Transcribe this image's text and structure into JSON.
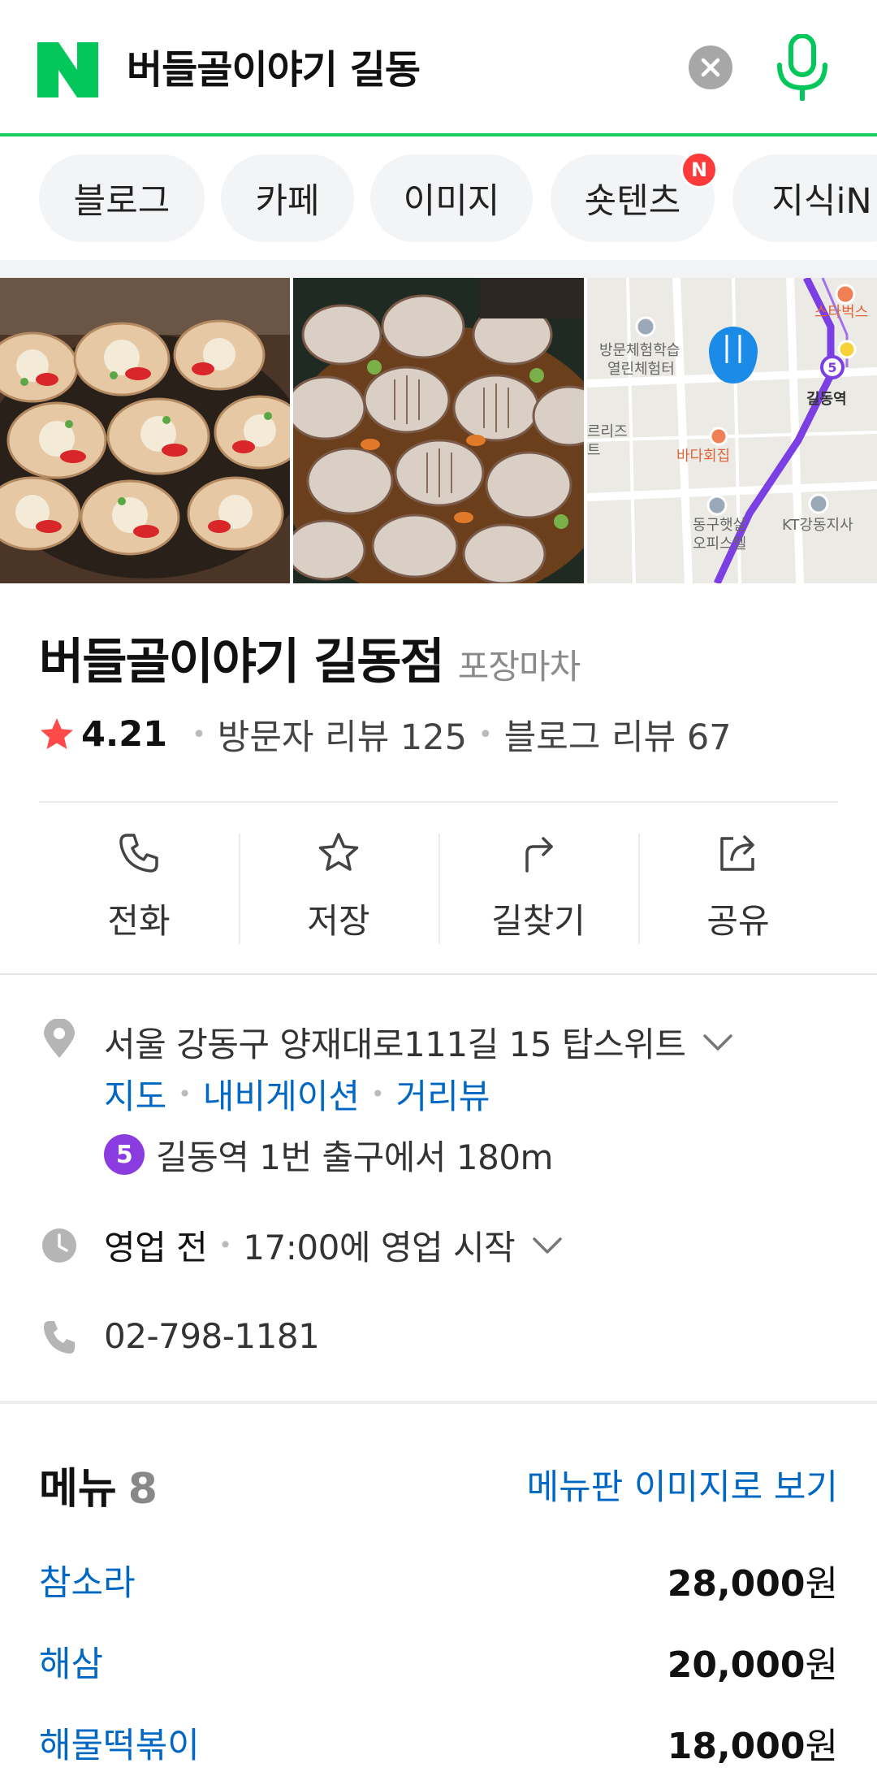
{
  "search": {
    "query": "버들골이야기 길동"
  },
  "tabs": [
    {
      "label": "블로그",
      "new": false
    },
    {
      "label": "카페",
      "new": false
    },
    {
      "label": "이미지",
      "new": false
    },
    {
      "label": "숏텐츠",
      "new": true,
      "badge": "N"
    },
    {
      "label": "지식iN",
      "new": false
    }
  ],
  "photos": {
    "map_labels": {
      "poi_1": "방문체험학습",
      "poi_1b": "열린체험터",
      "station": "길동역",
      "restaurant": "바다회집",
      "poi_2": "동구햇살",
      "poi_2b": "오피스텔",
      "poi_3": "KT강동지사",
      "poi_4": "스타벅스",
      "left_cut_1": "르리즈",
      "left_cut_2": "트"
    }
  },
  "place": {
    "name": "버들골이야기 길동점",
    "category": "포장마차",
    "rating": "4.21",
    "visitor_reviews": "방문자 리뷰 125",
    "blog_reviews": "블로그 리뷰 67"
  },
  "actions": [
    {
      "label": "전화",
      "icon": "phone-icon"
    },
    {
      "label": "저장",
      "icon": "star-outline-icon"
    },
    {
      "label": "길찾기",
      "icon": "directions-icon"
    },
    {
      "label": "공유",
      "icon": "share-icon"
    }
  ],
  "info": {
    "address": "서울 강동구 양재대로111길 15 탑스위트",
    "links": [
      "지도",
      "내비게이션",
      "거리뷰"
    ],
    "subway_line": "5",
    "subway_text": "길동역 1번 출구에서 180m",
    "status": "영업 전",
    "status_detail": "17:00에 영업 시작",
    "phone": "02-798-1181"
  },
  "menu": {
    "title": "메뉴",
    "count": "8",
    "image_link": "메뉴판 이미지로 보기",
    "items": [
      {
        "name": "참소라",
        "price": "28,000",
        "unit": "원"
      },
      {
        "name": "해삼",
        "price": "20,000",
        "unit": "원"
      },
      {
        "name": "해물떡볶이",
        "price": "18,000",
        "unit": "원"
      }
    ]
  },
  "colors": {
    "naver_green": "#03c75a",
    "link_blue": "#0068c3",
    "star_red": "#ff4a4a",
    "subway_purple": "#8b3ce1"
  }
}
